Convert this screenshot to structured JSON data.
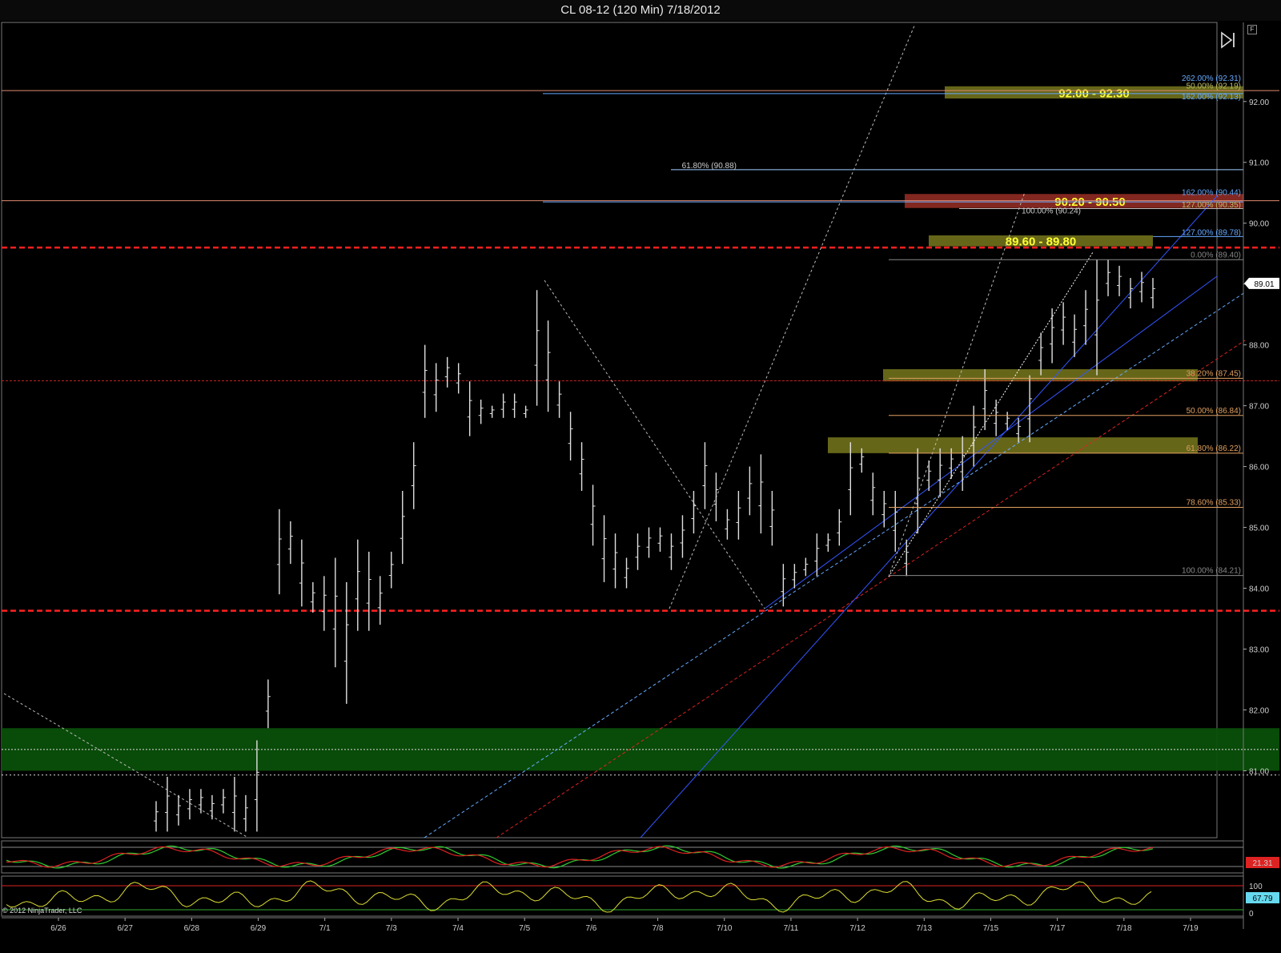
{
  "title": "CL 08-12 (120 Min)  7/18/2012",
  "copyright": "© 2012 NinjaTrader, LLC",
  "f_button": "F",
  "icons": [
    "play-end-icon"
  ],
  "colors": {
    "background": "#000000",
    "price_bar": "#e0e0e0",
    "support_resistance": "#ff2020",
    "green_zone": "#0a4f0a",
    "olive_zone": "#6b6b1a",
    "red_zone": "#8a2a22",
    "zone_text": "#ffff33",
    "fib_orange": "#e0a060",
    "fib_blue": "#66aaff",
    "trend_blue": "#3355ff",
    "trend_red": "#dd2222"
  },
  "chart_data": {
    "type": "candlestick",
    "symbol": "CL 08-12",
    "interval": "120 Min",
    "date": "7/18/2012",
    "ylim": [
      79.9,
      93.3
    ],
    "y_ticks": [
      "92.00",
      "91.00",
      "90.00",
      "89.00",
      "88.00",
      "87.00",
      "86.00",
      "85.00",
      "84.00",
      "83.00",
      "82.00",
      "81.00"
    ],
    "x_ticks": [
      "6/26",
      "6/27",
      "6/28",
      "6/29",
      "7/1",
      "7/3",
      "7/4",
      "7/5",
      "7/6",
      "7/8",
      "7/10",
      "7/11",
      "7/12",
      "7/13",
      "7/15",
      "7/17",
      "7/18",
      "7/19"
    ],
    "last_price": "89.01",
    "bars_hl": [
      [
        80.5,
        80.0
      ],
      [
        80.9,
        80.0
      ],
      [
        80.6,
        80.1
      ],
      [
        80.7,
        80.2
      ],
      [
        80.7,
        80.3
      ],
      [
        80.6,
        80.2
      ],
      [
        80.7,
        80.3
      ],
      [
        80.9,
        80.0
      ],
      [
        80.6,
        80.0
      ],
      [
        81.5,
        80.0
      ],
      [
        82.5,
        81.7
      ],
      [
        85.3,
        83.9
      ],
      [
        85.1,
        84.4
      ],
      [
        84.8,
        83.7
      ],
      [
        84.1,
        83.6
      ],
      [
        84.2,
        83.3
      ],
      [
        84.5,
        82.7
      ],
      [
        84.1,
        82.1
      ],
      [
        84.8,
        83.3
      ],
      [
        84.6,
        83.3
      ],
      [
        84.2,
        83.4
      ],
      [
        84.6,
        84.0
      ],
      [
        85.6,
        84.4
      ],
      [
        86.4,
        85.3
      ],
      [
        88.0,
        86.8
      ],
      [
        87.7,
        86.9
      ],
      [
        87.8,
        87.3
      ],
      [
        87.7,
        87.2
      ],
      [
        87.4,
        86.5
      ],
      [
        87.1,
        86.7
      ],
      [
        87.0,
        86.8
      ],
      [
        87.2,
        86.8
      ],
      [
        87.2,
        86.8
      ],
      [
        87.0,
        86.8
      ],
      [
        88.9,
        87.0
      ],
      [
        88.4,
        86.9
      ],
      [
        87.4,
        86.8
      ],
      [
        86.9,
        86.1
      ],
      [
        86.4,
        85.6
      ],
      [
        85.7,
        84.7
      ],
      [
        85.2,
        84.1
      ],
      [
        84.9,
        84.0
      ],
      [
        84.5,
        84.0
      ],
      [
        84.9,
        84.3
      ],
      [
        85.0,
        84.5
      ],
      [
        85.0,
        84.6
      ],
      [
        84.9,
        84.3
      ],
      [
        85.2,
        84.5
      ],
      [
        85.6,
        84.9
      ],
      [
        86.4,
        85.3
      ],
      [
        85.9,
        85.1
      ],
      [
        85.3,
        84.8
      ],
      [
        85.6,
        84.8
      ],
      [
        86.0,
        85.2
      ],
      [
        86.2,
        84.9
      ],
      [
        85.6,
        84.7
      ],
      [
        84.4,
        83.7
      ],
      [
        84.4,
        84.0
      ],
      [
        84.5,
        84.2
      ],
      [
        84.9,
        84.2
      ],
      [
        84.9,
        84.6
      ],
      [
        85.3,
        84.7
      ],
      [
        86.4,
        85.2
      ],
      [
        86.3,
        85.9
      ],
      [
        85.9,
        85.2
      ],
      [
        85.6,
        85.0
      ],
      [
        85.6,
        84.6
      ],
      [
        84.8,
        84.2
      ],
      [
        86.3,
        84.9
      ],
      [
        86.1,
        85.6
      ],
      [
        86.3,
        85.5
      ],
      [
        86.3,
        85.8
      ],
      [
        86.5,
        85.6
      ],
      [
        87.0,
        86.0
      ],
      [
        87.6,
        86.6
      ],
      [
        87.1,
        86.5
      ],
      [
        86.9,
        86.6
      ],
      [
        86.8,
        86.4
      ],
      [
        87.5,
        86.4
      ],
      [
        88.2,
        87.5
      ],
      [
        88.6,
        87.7
      ],
      [
        88.7,
        88.0
      ],
      [
        88.5,
        87.8
      ],
      [
        88.9,
        88.0
      ],
      [
        89.4,
        87.5
      ],
      [
        89.4,
        88.8
      ],
      [
        89.3,
        88.8
      ],
      [
        89.1,
        88.6
      ],
      [
        89.2,
        88.7
      ],
      [
        89.1,
        88.6
      ]
    ],
    "zones": [
      {
        "label": "92.00 - 92.30",
        "low": 92.05,
        "high": 92.25,
        "color": "olive"
      },
      {
        "label": "90.20 - 90.50",
        "low": 90.25,
        "high": 90.48,
        "color": "red"
      },
      {
        "label": "89.60 - 89.80",
        "low": 89.62,
        "high": 89.8,
        "color": "olive"
      },
      {
        "label": "",
        "low": 87.4,
        "high": 87.6,
        "color": "olive"
      },
      {
        "label": "",
        "low": 86.22,
        "high": 86.48,
        "color": "olive"
      },
      {
        "label": "",
        "low": 81.0,
        "high": 81.7,
        "color": "green"
      }
    ],
    "horizontal_levels": [
      {
        "value": 89.6,
        "style": "dashed-red"
      },
      {
        "value": 83.63,
        "style": "dashed-red"
      },
      {
        "value": 87.41,
        "style": "thin-red"
      },
      {
        "value": 92.18,
        "style": "thin-salmon"
      },
      {
        "value": 90.37,
        "style": "thin-salmon"
      },
      {
        "value": 80.93,
        "style": "dotted-white"
      }
    ],
    "fib_retracement": [
      {
        "label": "0.00% (89.40)",
        "value": 89.4
      },
      {
        "label": "38.20% (87.45)",
        "value": 87.45
      },
      {
        "label": "50.00% (86.84)",
        "value": 86.84
      },
      {
        "label": "61.80% (86.22)",
        "value": 86.22
      },
      {
        "label": "78.60% (85.33)",
        "value": 85.33
      },
      {
        "label": "100.00% (84.21)",
        "value": 84.21
      }
    ],
    "fib_extensions": [
      {
        "label": "262.00% (92.31)",
        "value": 92.31
      },
      {
        "label": "50.00% (92.19)",
        "value": 92.19
      },
      {
        "label": "162.00% (92.13)",
        "value": 92.13
      },
      {
        "label": "162.00% (90.44)",
        "value": 90.44
      },
      {
        "label": "127.00% (90.35)",
        "value": 90.35
      },
      {
        "label": "100.00% (90.24)",
        "value": 90.24
      },
      {
        "label": "127.00% (89.78)",
        "value": 89.78
      },
      {
        "label": "61.80% (90.88)",
        "value": 90.88
      }
    ],
    "indicator1": {
      "last_value": "21.31",
      "lines": [
        20,
        80
      ]
    },
    "indicator2": {
      "last_value": "67.79",
      "ticks": [
        "100",
        "0"
      ]
    }
  }
}
